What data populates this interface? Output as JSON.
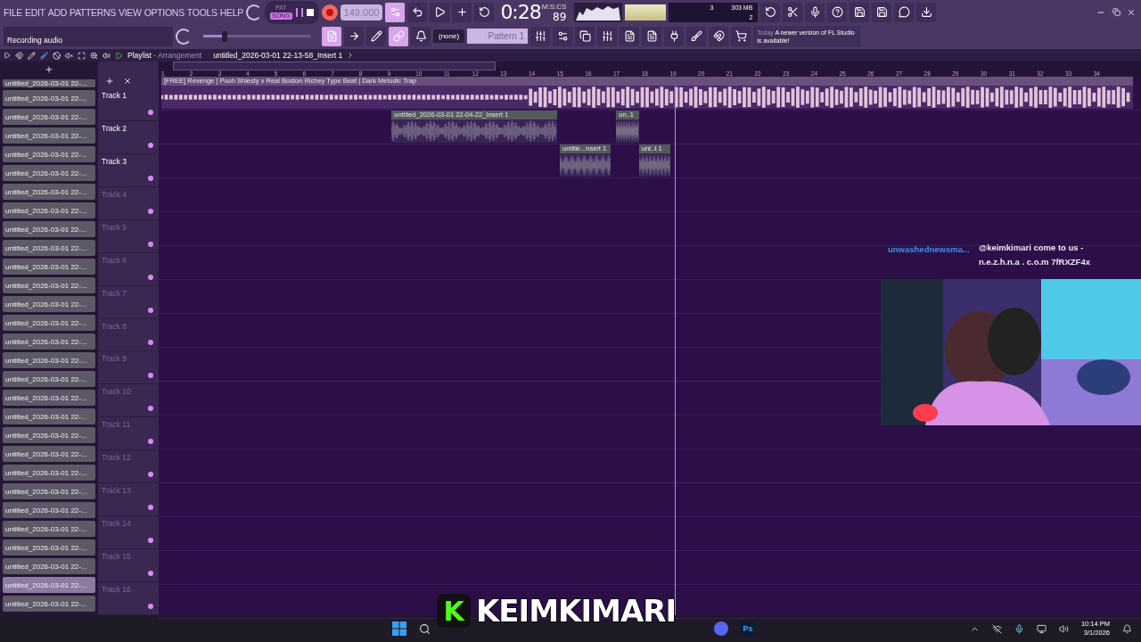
{
  "menu": [
    "FILE",
    "EDIT",
    "ADD",
    "PATTERNS",
    "VIEW",
    "OPTIONS",
    "TOOLS",
    "HELP"
  ],
  "hint": "Recording audio",
  "mode": [
    {
      "label": "PAT",
      "selected": false
    },
    {
      "label": "SONG",
      "selected": true
    }
  ],
  "tempo": "149.000",
  "pitch_slider": {
    "level": 0.2
  },
  "time": {
    "value": "0:28",
    "fraction": "89",
    "unit": "M:S:CS"
  },
  "cpu": {
    "cores": "3",
    "memory": "303 MB",
    "polyphony": "2"
  },
  "pattern_picker": {
    "channel": "(none)",
    "pattern": "Pattern 1"
  },
  "news": {
    "date": "Today",
    "message": "A newer version of FL Studio is available!"
  },
  "playlist": {
    "title": "Playlist",
    "subtitle": "- Arrangement",
    "file": "untitled_2026-03-01 22-13-58_Insert 1"
  },
  "browser_top": "untitled_2026-03-01 22-...",
  "browser": [
    {
      "label": "untitled_2026-03-01 22-...",
      "selected": false
    },
    {
      "label": "untitled_2026-03-01 22-...",
      "selected": false
    },
    {
      "label": "untitled_2026-03-01 22-...",
      "selected": false
    },
    {
      "label": "untitled_2026-03-01 22-...",
      "selected": false
    },
    {
      "label": "untitled_2026-03-01 22-...",
      "selected": false
    },
    {
      "label": "untitled_2026-03-01 22-...",
      "selected": false
    },
    {
      "label": "untitled_2026-03-01 22-...",
      "selected": false
    },
    {
      "label": "untitled_2026-03-01 22-...",
      "selected": false
    },
    {
      "label": "untitled_2026-03-01 22-...",
      "selected": false
    },
    {
      "label": "untitled_2026-03-01 22-...",
      "selected": false
    },
    {
      "label": "untitled_2026-03-01 22-...",
      "selected": false
    },
    {
      "label": "untitled_2026-03-01 22-...",
      "selected": false
    },
    {
      "label": "untitled_2026-03-01 22-...",
      "selected": false
    },
    {
      "label": "untitled_2026-03-01 22-...",
      "selected": false
    },
    {
      "label": "untitled_2026-03-01 22-...",
      "selected": false
    },
    {
      "label": "untitled_2026-03-01 22-...",
      "selected": false
    },
    {
      "label": "untitled_2026-03-01 22-...",
      "selected": false
    },
    {
      "label": "untitled_2026-03-01 22-...",
      "selected": false
    },
    {
      "label": "untitled_2026-03-01 22-...",
      "selected": false
    },
    {
      "label": "untitled_2026-03-01 22-...",
      "selected": false
    },
    {
      "label": "untitled_2026-03-01 22-...",
      "selected": false
    },
    {
      "label": "untitled_2026-03-01 22-...",
      "selected": false
    },
    {
      "label": "untitled_2026-03-01 22-...",
      "selected": false
    },
    {
      "label": "untitled_2026-03-01 22-...",
      "selected": false
    },
    {
      "label": "untitled_2026-03-01 22-...",
      "selected": false
    },
    {
      "label": "untitled_2026-03-01 22-...",
      "selected": false
    },
    {
      "label": "untitled_2026-03-01 22-...",
      "selected": true
    },
    {
      "label": "untitled_2026-03-01 22-...",
      "selected": false
    }
  ],
  "ruler": [
    "1",
    "2",
    "3",
    "4",
    "5",
    "6",
    "7",
    "8",
    "9",
    "10",
    "11",
    "12",
    "13",
    "14",
    "15",
    "16",
    "17",
    "18",
    "19",
    "20",
    "21",
    "22",
    "23",
    "24",
    "25",
    "26",
    "27",
    "28",
    "29",
    "30",
    "31",
    "32",
    "33",
    "34"
  ],
  "tracks": [
    {
      "name": "Track 1",
      "active": true,
      "clips": [
        {
          "title": "[FREE] Revenge  |  Pooh Shiesty x Real Boston Richey Type Beat  |  Dark Melodic Trap"
        }
      ]
    },
    {
      "name": "Track 2",
      "active": true,
      "clips": [
        {
          "title": "untitled_2026-03-01 22-04-22_Insert 1"
        },
        {
          "title": "un..1"
        }
      ]
    },
    {
      "name": "Track 3",
      "active": true,
      "clips": [
        {
          "title": "untitle...nsert 1"
        },
        {
          "title": "unt..t 1"
        }
      ]
    },
    {
      "name": "Track 4",
      "active": false
    },
    {
      "name": "Track 5",
      "active": false
    },
    {
      "name": "Track 6",
      "active": false
    },
    {
      "name": "Track 7",
      "active": false
    },
    {
      "name": "Track 8",
      "active": false
    },
    {
      "name": "Track 9",
      "active": false
    },
    {
      "name": "Track 10",
      "active": false
    },
    {
      "name": "Track 11",
      "active": false
    },
    {
      "name": "Track 12",
      "active": false
    },
    {
      "name": "Track 13",
      "active": false
    },
    {
      "name": "Track 14",
      "active": false
    },
    {
      "name": "Track 15",
      "active": false
    },
    {
      "name": "Track 16",
      "active": false
    }
  ],
  "chat": {
    "user": "unwashednewsma...",
    "message": "@keimkimari come to us - n.e.z.h.n.a . c.o.m 7fRXZF4x"
  },
  "stream_overlay": {
    "logo_letter": "K",
    "name": "KEIMKIMARI"
  },
  "taskbar": {
    "photoshop": "Ps",
    "time": "10:14 PM",
    "date": "3/1/2026"
  }
}
